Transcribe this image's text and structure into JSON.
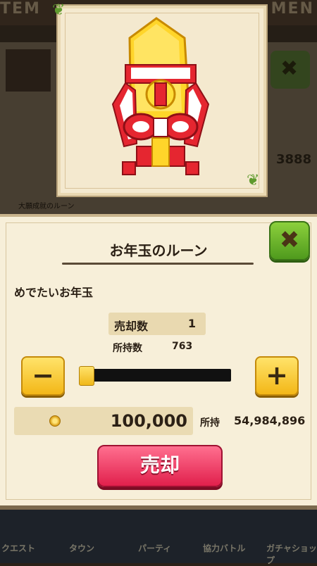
{
  "background": {
    "tab_left": "TEM",
    "tab_right": "MEN",
    "stat_number": "3888",
    "small_label": "大願成就のルーン",
    "nav": [
      "クエスト",
      "タウン",
      "パーティ",
      "協力バトル",
      "ガチャショップ"
    ]
  },
  "item_card": {
    "image_icon": "new-year-gift-rune-icon"
  },
  "dialog": {
    "title": "お年玉のルーン",
    "close_icon": "close-x-icon",
    "description": "めでたいお年玉",
    "sell_count_label": "売却数",
    "sell_count_value": "1",
    "owned_label": "所持数",
    "owned_value": "763",
    "minus_label": "−",
    "plus_label": "+",
    "slider_value_fraction": 0.0,
    "price_icon": "coin-icon",
    "price_value": "100,000",
    "held_label": "所持",
    "held_value": "54,984,896",
    "sell_button_label": "売却"
  },
  "colors": {
    "sell_button": "#e1204c",
    "close_button": "#4f9a1d",
    "step_button": "#f3b717",
    "parchment": "#f7efd9"
  }
}
